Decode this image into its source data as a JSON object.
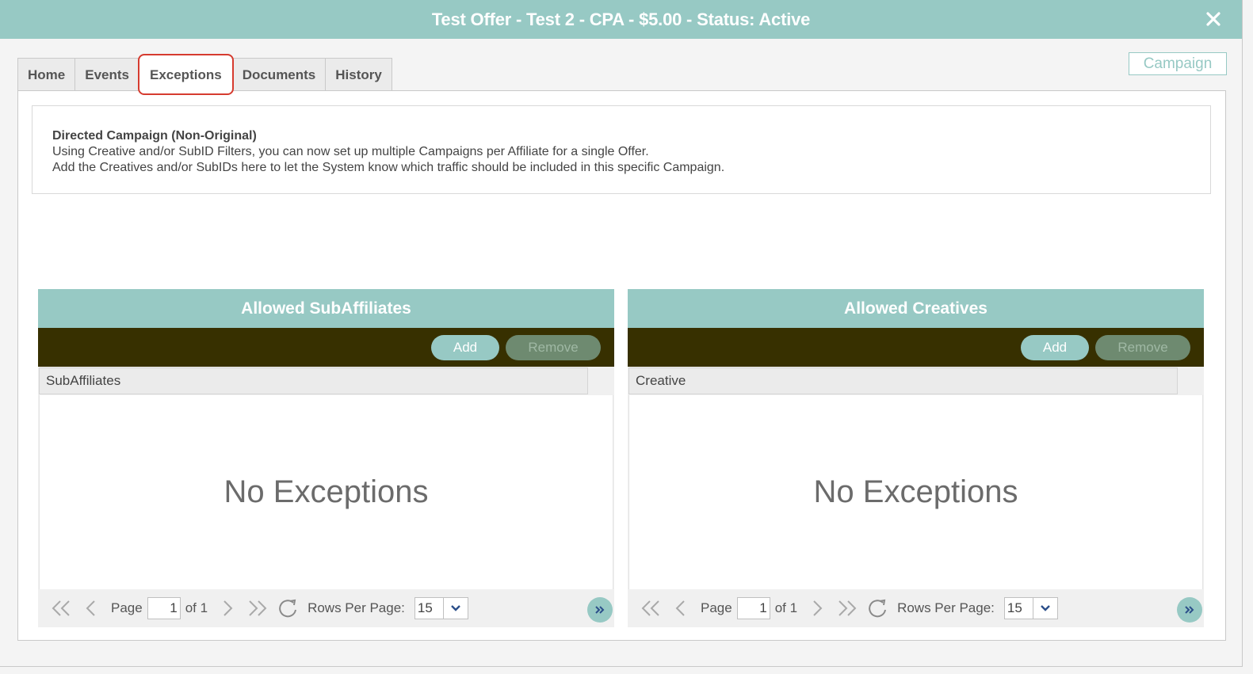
{
  "window": {
    "title": "Test Offer - Test 2 - CPA - $5.00 - Status: Active"
  },
  "tabs": [
    {
      "label": "Home"
    },
    {
      "label": "Events"
    },
    {
      "label": "Exceptions",
      "active": true
    },
    {
      "label": "Documents"
    },
    {
      "label": "History"
    }
  ],
  "campaign_button": {
    "label": "Campaign"
  },
  "info": {
    "heading": "Directed Campaign (Non-Original)",
    "line1": "Using Creative and/or SubID Filters, you can now set up multiple Campaigns per Affiliate for a single Offer.",
    "line2": "Add the Creatives and/or SubIDs here to let the System know which traffic should be included in this specific Campaign."
  },
  "panels": {
    "subaffiliates": {
      "title": "Allowed SubAffiliates",
      "add_label": "Add",
      "remove_label": "Remove",
      "column_header": "SubAffiliates",
      "empty_text": "No Exceptions",
      "pager": {
        "page_label": "Page",
        "page_value": "1",
        "of_label": "of 1",
        "rows_label": "Rows Per Page:",
        "rows_value": "15"
      }
    },
    "creatives": {
      "title": "Allowed Creatives",
      "add_label": "Add",
      "remove_label": "Remove",
      "column_header": "Creative",
      "empty_text": "No Exceptions",
      "pager": {
        "page_label": "Page",
        "page_value": "1",
        "of_label": "of 1",
        "rows_label": "Rows Per Page:",
        "rows_value": "15"
      }
    }
  },
  "colors": {
    "accent": "#97c9c4",
    "toolbar": "#373000",
    "active_tab_outline": "#d63b2f"
  },
  "icons": {
    "close": "close-icon",
    "first": "first-page-icon",
    "prev": "prev-page-icon",
    "next": "next-page-icon",
    "last": "last-page-icon",
    "refresh": "refresh-icon",
    "dropdown": "chevron-down-icon",
    "more": "double-chevron-right-icon"
  }
}
